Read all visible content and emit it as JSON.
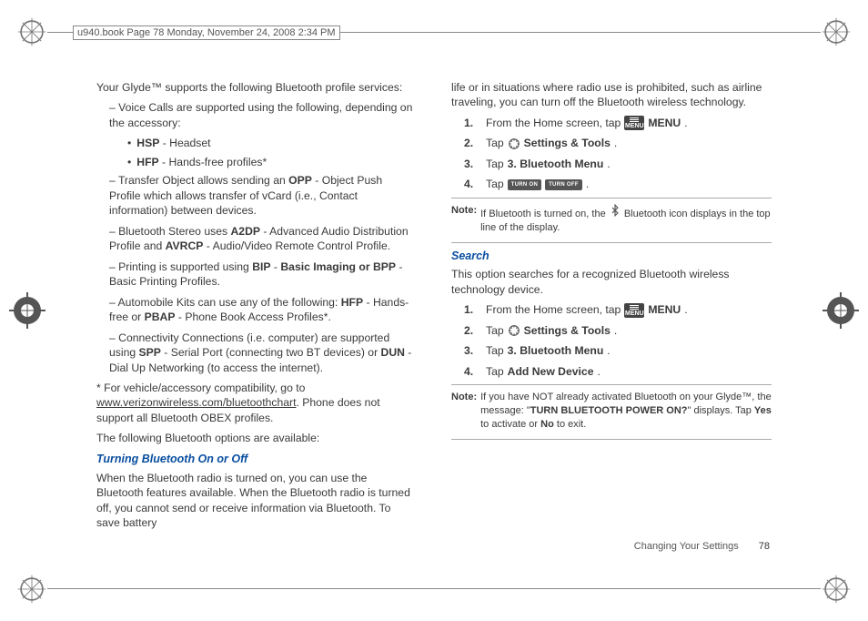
{
  "page_header": "u940.book  Page 78  Monday, November 24, 2008  2:34 PM",
  "left": {
    "intro": "Your Glyde™ supports the following Bluetooth profile services:",
    "b1_pre": "– Voice Calls are supported using the following, depending on the accessory:",
    "sub1_label": "HSP",
    "sub1_rest": " - Headset",
    "sub2_label": "HFP",
    "sub2_rest": " - Hands-free profiles*",
    "b2_pre": "– Transfer Object allows sending an ",
    "b2_bold": "OPP",
    "b2_post": " - Object Push Profile which allows transfer of vCard (i.e., Contact information) between devices.",
    "b3_pre": "– Bluetooth Stereo uses ",
    "b3_bold": "A2DP",
    "b3_mid": " - Advanced Audio Distribution Profile and ",
    "b3_bold2": "AVRCP",
    "b3_post": " - Audio/Video Remote Control Profile.",
    "b4_pre": "– Printing is supported using ",
    "b4_bold": "BIP",
    "b4_mid": " - ",
    "b4_bold2": "Basic Imaging or BPP",
    "b4_post": " - Basic Printing Profiles.",
    "b5_pre": "– Automobile Kits can use any of the following: ",
    "b5_bold": "HFP",
    "b5_mid": " - Hands-free or ",
    "b5_bold2": "PBAP",
    "b5_post": " - Phone Book Access Profiles*.",
    "b6_pre": "– Connectivity Connections (i.e. computer) are supported using ",
    "b6_bold": "SPP",
    "b6_mid": " - Serial Port (connecting two BT devices) or ",
    "b6_bold2": "DUN",
    "b6_post": " - Dial Up Networking (to access the internet).",
    "star_pre": "* For vehicle/accessory compatibility, go to ",
    "star_link": "www.verizonwireless.com/bluetoothchart",
    "star_post": ". Phone does not support all Bluetooth OBEX profiles.",
    "options_line": "The following Bluetooth options are available:",
    "heading1": "Turning Bluetooth On or Off",
    "para1": "When the Bluetooth radio is turned on, you can use the Bluetooth features available. When the Bluetooth radio is turned off, you cannot send or receive information via Bluetooth. To save battery"
  },
  "right": {
    "cont": "life or in situations where radio use is prohibited, such as airline traveling, you can turn off the Bluetooth wireless technology.",
    "s1_num": "1.",
    "s1_text_a": "From the Home screen, tap",
    "s1_menu": "MENU",
    "s1_text_b": ".",
    "s2_num": "2.",
    "s2_text_a": "Tap",
    "s2_bold": "Settings & Tools",
    "s2_text_b": ".",
    "s3_num": "3.",
    "s3_text_a": "Tap ",
    "s3_bold": "3. Bluetooth Menu",
    "s3_text_b": ".",
    "s4_num": "4.",
    "s4_text_a": "Tap",
    "s4_turnon": "TURN ON",
    "s4_turnoff": "TURN OFF",
    "s4_text_b": ".",
    "note1_label": "Note:",
    "note1_body_a": "If Bluetooth is turned on, the ",
    "note1_body_b": " Bluetooth icon displays in the top line of the display.",
    "heading_search": "Search",
    "search_para": "This option searches for a recognized Bluetooth wireless technology device.",
    "r1_num": "1.",
    "r1_text_a": "From the Home screen, tap",
    "r1_menu": "MENU",
    "r1_text_b": ".",
    "r2_num": "2.",
    "r2_text_a": "Tap",
    "r2_bold": "Settings & Tools",
    "r2_text_b": ".",
    "r3_num": "3.",
    "r3_text_a": "Tap ",
    "r3_bold": "3. Bluetooth Menu",
    "r3_text_b": ".",
    "r4_num": "4.",
    "r4_text_a": "Tap ",
    "r4_bold": "Add New Device",
    "r4_text_b": ".",
    "note2_label": "Note:",
    "note2_body_a": "If you have NOT already activated Bluetooth on your Glyde™, the message: \"",
    "note2_bold": "TURN BLUETOOTH POWER ON?",
    "note2_body_b": "\" displays. Tap ",
    "note2_yes": "Yes",
    "note2_body_c": " to activate or ",
    "note2_no": "No",
    "note2_body_d": " to exit."
  },
  "footer": {
    "section": "Changing Your Settings",
    "page": "78"
  }
}
